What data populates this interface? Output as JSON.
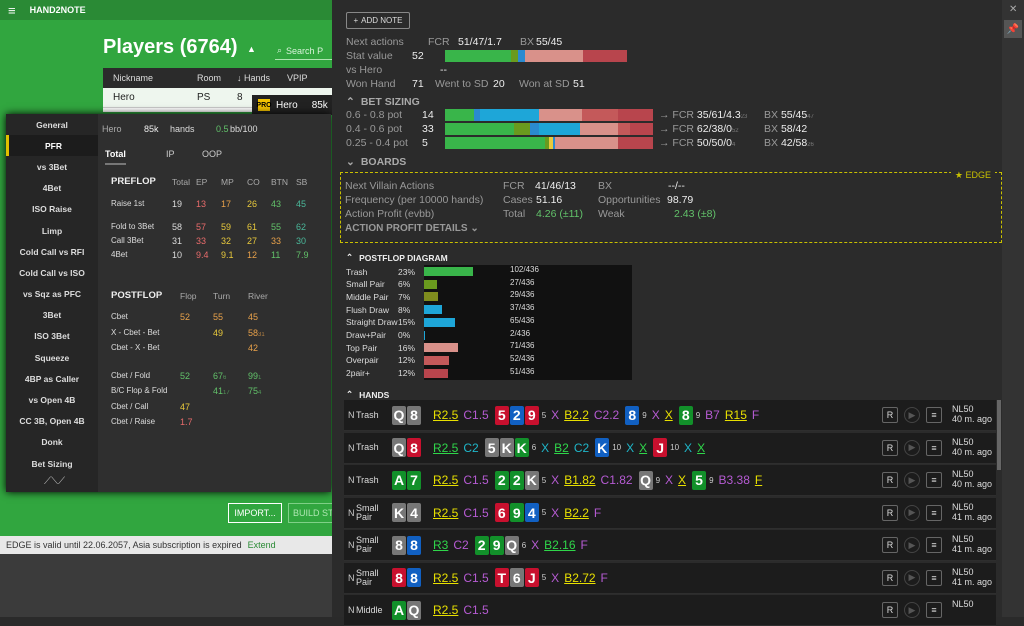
{
  "app": {
    "title": "HAND2NOTE",
    "players_title": "Players (6764)",
    "search_placeholder": "Search P",
    "table_headers": [
      "Nickname",
      "Room",
      "Hands",
      "VPIP"
    ],
    "hero_row": {
      "name": "Hero",
      "room": "PS",
      "hands": "8"
    },
    "hero_popup": {
      "badge": "PRO",
      "name": "Hero",
      "hands": "85k"
    },
    "import_label": "IMPORT...",
    "build_label": "BUILD ST",
    "edge_status": "EDGE is valid until 22.06.2057, Asia subscription is expired",
    "edge_extend": "Extend"
  },
  "stats": {
    "nav": [
      "General",
      "PFR",
      "vs 3Bet",
      "4Bet",
      "ISO Raise",
      "Limp",
      "Cold Call vs RFI",
      "Cold Call vs ISO",
      "vs Sqz as PFC",
      "3Bet",
      "ISO 3Bet",
      "Squeeze",
      "4BP as Caller",
      "vs Open 4B",
      "CC 3B, Open 4B",
      "Donk",
      "Bet Sizing"
    ],
    "active_nav": "PFR",
    "header": {
      "name": "Hero",
      "hands": "85k",
      "hands_label": "hands",
      "bb": "0.5",
      "bb_label": "bb/100"
    },
    "tabs": [
      "Total",
      "IP",
      "OOP"
    ],
    "preflop": {
      "title": "PREFLOP",
      "cols": [
        "Total",
        "EP",
        "MP",
        "CO",
        "BTN",
        "SB"
      ],
      "rows": [
        {
          "label": "Raise 1st",
          "vals": [
            "19",
            "13",
            "17",
            "26",
            "43",
            "45"
          ]
        },
        {
          "label": "Fold to 3Bet",
          "vals": [
            "58",
            "57",
            "59",
            "61",
            "55",
            "62"
          ]
        },
        {
          "label": "Call 3Bet",
          "vals": [
            "31",
            "33",
            "32",
            "27",
            "33",
            "30"
          ]
        },
        {
          "label": "4Bet",
          "vals": [
            "10",
            "9.4",
            "9.1",
            "12",
            "11",
            "7.9"
          ]
        }
      ]
    },
    "postflop": {
      "title": "POSTFLOP",
      "cols": [
        "Flop",
        "Turn",
        "River"
      ],
      "rows": [
        {
          "label": "Cbet",
          "vals": [
            "52",
            "55",
            "45"
          ]
        },
        {
          "label": "X - Cbet - Bet",
          "vals": [
            "",
            "49",
            "58"
          ],
          "sub": "31"
        },
        {
          "label": "Cbet - X - Bet",
          "vals": [
            "",
            "",
            "42"
          ]
        },
        {
          "label": "Cbet / Fold",
          "vals": [
            "52",
            "67",
            "99"
          ],
          "subs": [
            "",
            "6",
            "1"
          ]
        },
        {
          "label": "B/C Flop & Fold",
          "vals": [
            "",
            "41",
            "75"
          ],
          "subs": [
            "",
            "17",
            "4"
          ]
        },
        {
          "label": "Cbet / Call",
          "vals": [
            "47",
            "",
            ""
          ]
        },
        {
          "label": "Cbet / Raise",
          "vals": [
            "1.7",
            "",
            ""
          ]
        }
      ]
    }
  },
  "panel": {
    "add_note": "ADD NOTE",
    "next_actions": {
      "label": "Next actions",
      "fcr_label": "FCR",
      "fcr": "51/47/1.7",
      "bx_label": "BX",
      "bx": "55/45"
    },
    "stat_value": {
      "label": "Stat value",
      "value": "52"
    },
    "vs_hero": {
      "label": "vs Hero",
      "value": "--"
    },
    "won_hand": {
      "label": "Won Hand",
      "value": "71",
      "wtsd_label": "Went to SD",
      "wtsd": "20",
      "wsd_label": "Won at SD",
      "wsd": "51"
    },
    "bet_sizing": {
      "title": "BET SIZING",
      "rows": [
        {
          "label": "0.6 - 0.8 pot",
          "n": "14",
          "fcr": "35/61/4.3",
          "fcr_sub": "23",
          "bx": "55/45",
          "bx_sub": "47"
        },
        {
          "label": "0.4 - 0.6 pot",
          "n": "33",
          "fcr": "62/38/0",
          "fcr_sub": "52",
          "bx": "58/42",
          "bx_sub": ""
        },
        {
          "label": "0.25 - 0.4 pot",
          "n": "5",
          "fcr": "50/50/0",
          "fcr_sub": "4",
          "bx": "42/58",
          "bx_sub": "26"
        }
      ]
    },
    "boards_title": "BOARDS",
    "edge": {
      "tag": "EDGE",
      "next_villain": "Next Villain Actions",
      "frequency": "Frequency (per 10000 hands)",
      "action_profit": "Action Profit (evbb)",
      "details": "ACTION PROFIT DETAILS",
      "fcr_label": "FCR",
      "fcr": "41/46/13",
      "bx_label": "BX",
      "bx": "--/--",
      "cases_label": "Cases",
      "cases": "51.16",
      "opp_label": "Opportunities",
      "opp": "98.79",
      "total_label": "Total",
      "total": "4.26 (±11)",
      "weak_label": "Weak",
      "weak": "2.43 (±8)"
    },
    "postflop_diagram": {
      "title": "POSTFLOP DIAGRAM",
      "rows": [
        {
          "name": "Trash",
          "pct": "23%",
          "cnt": "102/436",
          "frac": 0.234,
          "color": "#39b54a"
        },
        {
          "name": "Small Pair",
          "pct": "6%",
          "cnt": "27/436",
          "frac": 0.062,
          "color": "#6a9a1e"
        },
        {
          "name": "Middle Pair",
          "pct": "7%",
          "cnt": "29/436",
          "frac": 0.067,
          "color": "#7f8c1e"
        },
        {
          "name": "Flush Draw",
          "pct": "8%",
          "cnt": "37/436",
          "frac": 0.085,
          "color": "#1ea6d8"
        },
        {
          "name": "Straight Draw",
          "pct": "15%",
          "cnt": "65/436",
          "frac": 0.149,
          "color": "#1ea6d8"
        },
        {
          "name": "Draw+Pair",
          "pct": "0%",
          "cnt": "2/436",
          "frac": 0.005,
          "color": "#1ea6d8"
        },
        {
          "name": "Top Pair",
          "pct": "16%",
          "cnt": "71/436",
          "frac": 0.163,
          "color": "#d9918a"
        },
        {
          "name": "Overpair",
          "pct": "12%",
          "cnt": "52/436",
          "frac": 0.119,
          "color": "#c4595a"
        },
        {
          "name": "2pair+",
          "pct": "12%",
          "cnt": "51/436",
          "frac": 0.117,
          "color": "#b8454d"
        }
      ]
    },
    "hands_title": "HANDS",
    "hands": [
      {
        "n": "N",
        "cat": "Trash",
        "info1": "NL50",
        "info2": "40 m. ago"
      },
      {
        "n": "N",
        "cat": "Trash",
        "info1": "NL50",
        "info2": "40 m. ago"
      },
      {
        "n": "N",
        "cat": "Trash",
        "info1": "NL50",
        "info2": "40 m. ago"
      },
      {
        "n": "N",
        "cat": "Small Pair",
        "info1": "NL50",
        "info2": "41 m. ago"
      },
      {
        "n": "N",
        "cat": "Small Pair",
        "info1": "NL50",
        "info2": "41 m. ago"
      },
      {
        "n": "N",
        "cat": "Small Pair",
        "info1": "NL50",
        "info2": "41 m. ago"
      },
      {
        "n": "N",
        "cat": "Middle",
        "info1": "NL50",
        "info2": ""
      }
    ]
  }
}
